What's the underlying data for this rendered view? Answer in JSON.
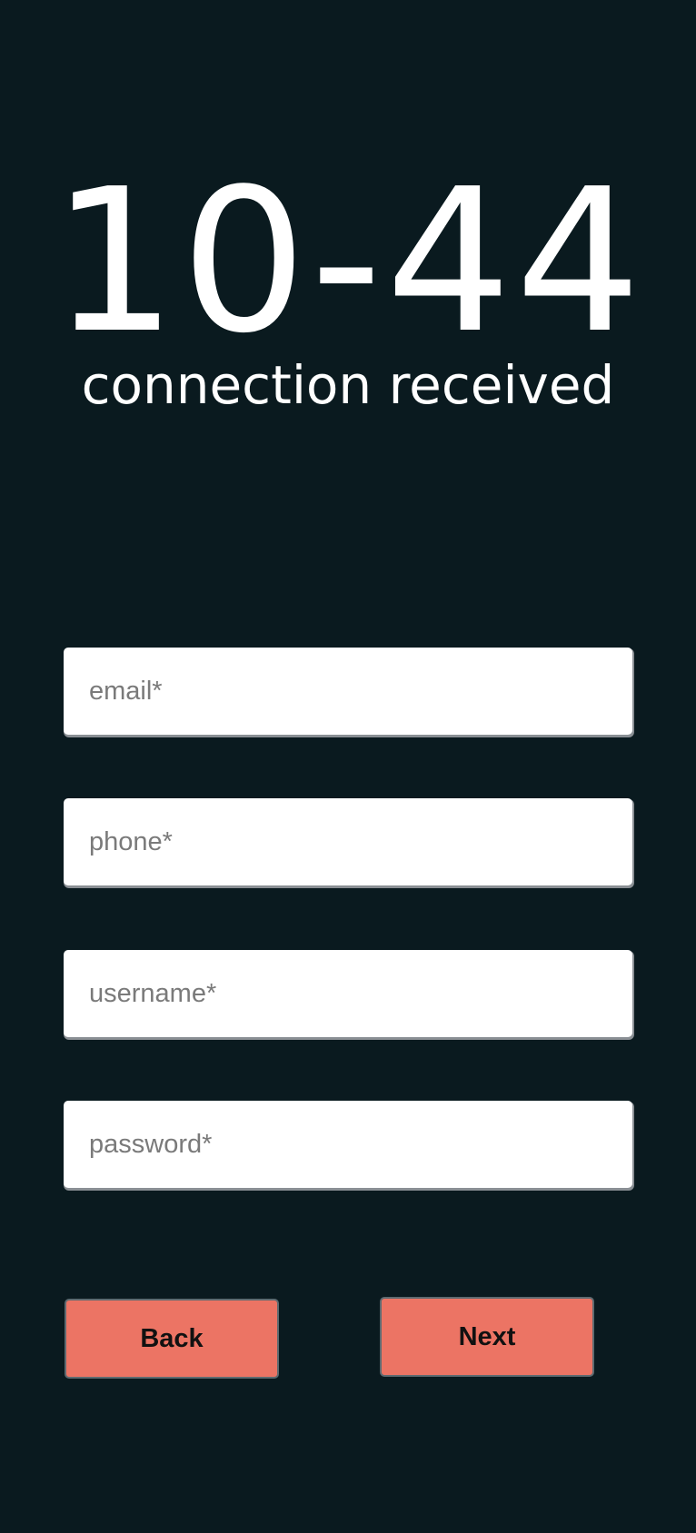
{
  "logo": {
    "text": "10-44",
    "subtitle": "connection received"
  },
  "form": {
    "email_placeholder": "email*",
    "phone_placeholder": "phone*",
    "username_placeholder": "username*",
    "password_placeholder": "password*"
  },
  "buttons": {
    "back_label": "Back",
    "next_label": "Next"
  },
  "colors": {
    "background": "#0a1a1f",
    "button": "#ec7464",
    "text_light": "#ffffff"
  }
}
